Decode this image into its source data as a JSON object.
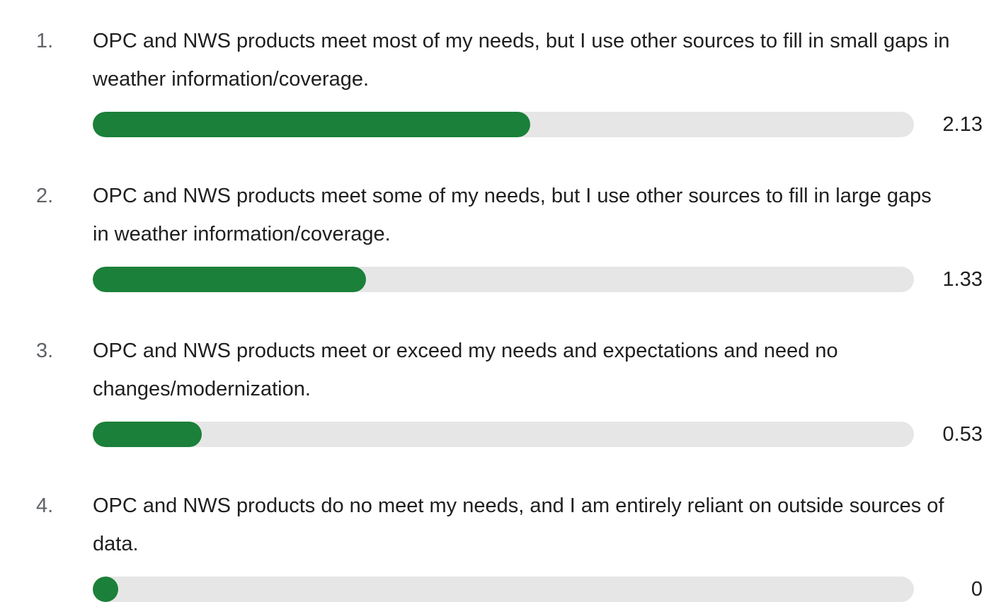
{
  "chart_data": {
    "type": "bar",
    "orientation": "horizontal",
    "xlim": [
      0,
      4
    ],
    "grid": false,
    "accent_color": "#1b8039",
    "track_color": "#e6e6e6",
    "items": [
      {
        "rank": "1.",
        "label": "OPC and NWS products meet most of my needs, but I use other sources to fill in small gaps in weather information/coverage.",
        "value": 2.13,
        "value_label": "2.13"
      },
      {
        "rank": "2.",
        "label": "OPC and NWS products meet some of my needs, but I use other sources to fill in large gaps in weather information/coverage.",
        "value": 1.33,
        "value_label": "1.33"
      },
      {
        "rank": "3.",
        "label": "OPC and NWS products meet or exceed my needs and expectations and need no changes/modernization.",
        "value": 0.53,
        "value_label": "0.53"
      },
      {
        "rank": "4.",
        "label": "OPC and NWS products do no meet my needs, and I am entirely reliant on outside sources of data.",
        "value": 0,
        "value_label": "0"
      }
    ]
  }
}
